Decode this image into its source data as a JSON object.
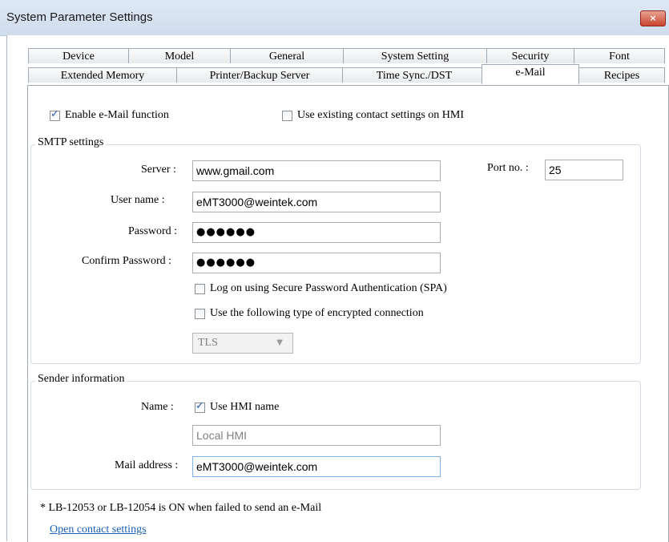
{
  "window": {
    "title": "System Parameter Settings",
    "close_glyph": "×"
  },
  "tabs_row1": [
    "Device",
    "Model",
    "General",
    "System Setting",
    "Security",
    "Font"
  ],
  "tabs_row2": [
    "Extended Memory",
    "Printer/Backup Server",
    "Time Sync./DST",
    "e-Mail",
    "Recipes"
  ],
  "active_tab": "e-Mail",
  "email": {
    "enable_label": "Enable e-Mail function",
    "enable_checked": true,
    "use_existing_label": "Use existing contact settings on HMI",
    "use_existing_checked": false
  },
  "smtp": {
    "legend": "SMTP settings",
    "server_label": "Server :",
    "server_value": "www.gmail.com",
    "port_label": "Port no. :",
    "port_value": "25",
    "username_label": "User name :",
    "username_value": "eMT3000@weintek.com",
    "password_label": "Password :",
    "password_value": "●●●●●●",
    "confirm_label": "Confirm Password :",
    "confirm_value": "●●●●●●",
    "spa_label": "Log on using Secure Password Authentication (SPA)",
    "spa_checked": false,
    "encrypt_label": "Use the following type of encrypted connection",
    "encrypt_checked": false,
    "encrypt_type": "TLS"
  },
  "sender": {
    "legend": "Sender information",
    "name_label": "Name :",
    "use_hmi_label": "Use HMI name",
    "use_hmi_checked": true,
    "name_value": "Local HMI",
    "mail_label": "Mail address :",
    "mail_value": "eMT3000@weintek.com"
  },
  "note": "* LB-12053 or LB-12054 is ON when failed to send an e-Mail",
  "contact_link": "Open contact settings"
}
